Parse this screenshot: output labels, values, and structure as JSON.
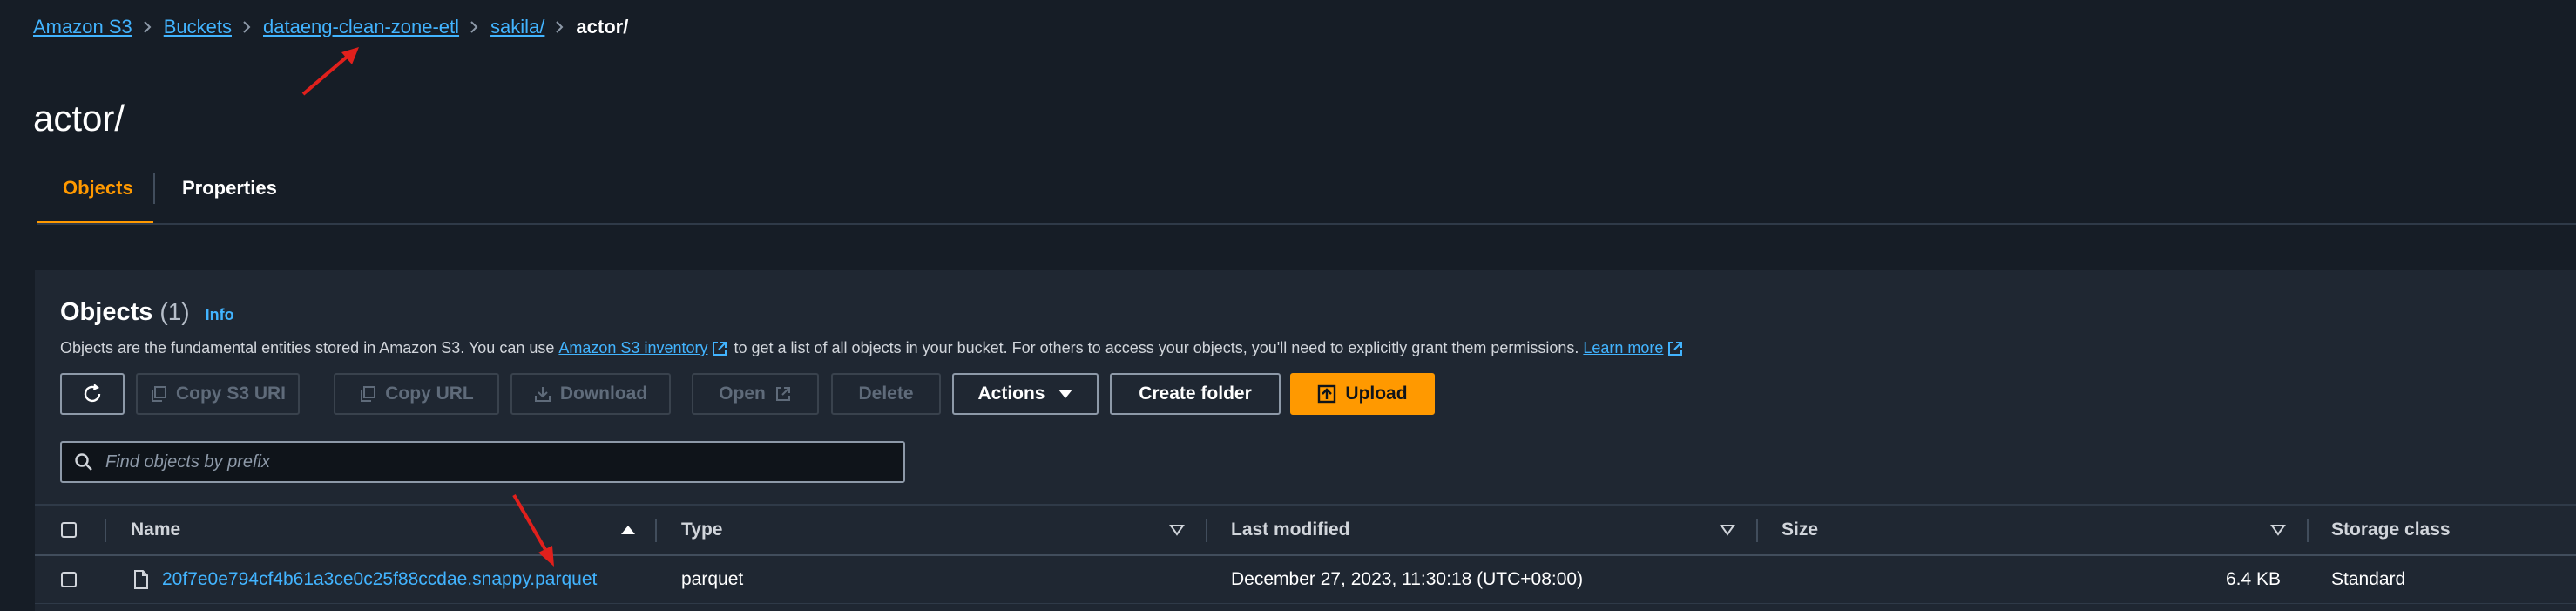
{
  "breadcrumb": {
    "items": [
      "Amazon S3",
      "Buckets",
      "dataeng-clean-zone-etl",
      "sakila/"
    ],
    "current": "actor/"
  },
  "page": {
    "title": "actor/"
  },
  "tabs": [
    {
      "label": "Objects",
      "active": true
    },
    {
      "label": "Properties",
      "active": false
    }
  ],
  "objects_panel": {
    "title": "Objects",
    "count": "(1)",
    "info": "Info",
    "description_before": "Objects are the fundamental entities stored in Amazon S3. You can use",
    "inventory_link": "Amazon S3 inventory",
    "description_after": "to get a list of all objects in your bucket. For others to access your objects, you'll need to explicitly grant them permissions.",
    "learn_more": "Learn more"
  },
  "toolbar": {
    "copy_s3_uri": "Copy S3 URI",
    "copy_url": "Copy URL",
    "download": "Download",
    "open": "Open",
    "delete": "Delete",
    "actions": "Actions",
    "create_folder": "Create folder",
    "upload": "Upload"
  },
  "search": {
    "placeholder": "Find objects by prefix",
    "value": ""
  },
  "table": {
    "columns": [
      "Name",
      "Type",
      "Last modified",
      "Size",
      "Storage class"
    ],
    "rows": [
      {
        "name": "20f7e0e794cf4b61a3ce0c25f88ccdae.snappy.parquet",
        "type": "parquet",
        "last_modified": "December 27, 2023, 11:30:18 (UTC+08:00)",
        "size": "6.4 KB",
        "storage_class": "Standard"
      }
    ]
  },
  "colors": {
    "accent": "#ff9900",
    "link": "#42b4ff",
    "background": "#161d26",
    "annotation_arrow": "#e0201c"
  }
}
